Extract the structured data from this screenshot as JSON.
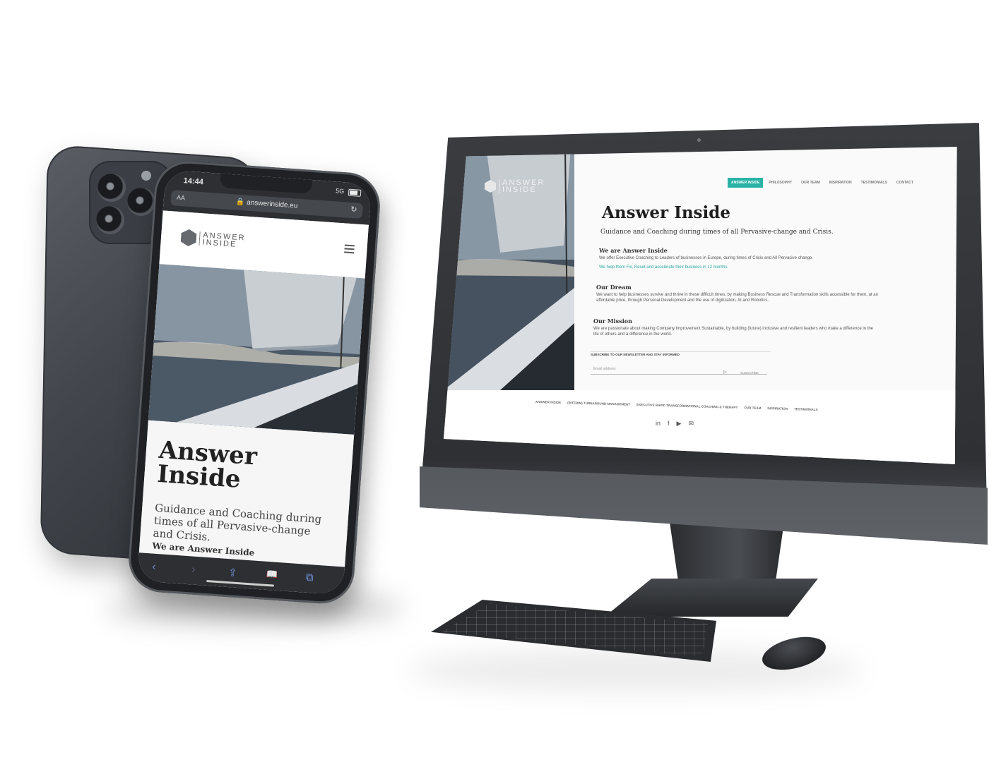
{
  "phone": {
    "status_time": "14:44",
    "status_network": "5G",
    "reader_label": "AA",
    "url": "answerinside.eu",
    "reload_icon": "reload-icon",
    "logo_line1": "ANSWER",
    "logo_line2": "INSIDE",
    "menu_icon": "hamburger-menu-icon",
    "title_line1": "Answer",
    "title_line2": "Inside",
    "subtitle": "Guidance and Coaching during times of all Pervasive-change and Crisis.",
    "section_heading": "We are Answer Inside",
    "toolbar": {
      "back": "‹",
      "forward": "›",
      "share": "⇪",
      "bookmarks": "📖",
      "tabs": "⧉"
    }
  },
  "monitor": {
    "logo_line1": "ANSWER",
    "logo_line2": "INSIDE",
    "nav": [
      "ANSWER INSIDE",
      "PHILOSOPHY",
      "OUR TEAM",
      "INSPIRATION",
      "TESTIMONIALS",
      "CONTACT"
    ],
    "nav_active_index": 0,
    "title": "Answer Inside",
    "subtitle": "Guidance and Coaching during times of all Pervasive-change and Crisis.",
    "sections": [
      {
        "heading": "We are Answer Inside",
        "text": "We offer Executive Coaching to Leaders of businesses in Europe, during times of Crisis and All Pervasive change.",
        "highlight": "We help them Fix, Reset and accelerate their business in 12 months."
      },
      {
        "heading": "Our Dream",
        "text": "We want to help businesses survive and thrive in these difficult times, by making Business Rescue and Transformation skills accessible for them, at an affordable price, through Personal Development and the use of digitization, AI and Robotics."
      },
      {
        "heading": "Our Mission",
        "text": "We are passionate about making Company Improvement Sustainable, by building (future) inclusive and resilient leaders who make a difference in the life of others and a difference in the world."
      }
    ],
    "newsletter_label": "SUBSCRIBE TO OUR NEWSLETTER AND STAY INFORMED",
    "email_placeholder": "Email address",
    "subscribe_label": "SUBSCRIBE",
    "footer_links": [
      "ANSWER INSIDE",
      "(INTERIM) TURNAROUND MANAGEMENT",
      "EXECUTIVE RAPID TRANSFORMATIONAL COACHING & THERAPY",
      "OUR TEAM",
      "INSPIRATION",
      "TESTIMONIALS"
    ],
    "social": [
      "in",
      "f",
      "▶",
      "✉"
    ],
    "social_icons": [
      "linkedin-icon",
      "facebook-icon",
      "youtube-icon",
      "email-icon"
    ]
  },
  "colors": {
    "accent": "#29b3a6",
    "device_dark": "#2e3034",
    "screen_bg": "#fafafa"
  }
}
